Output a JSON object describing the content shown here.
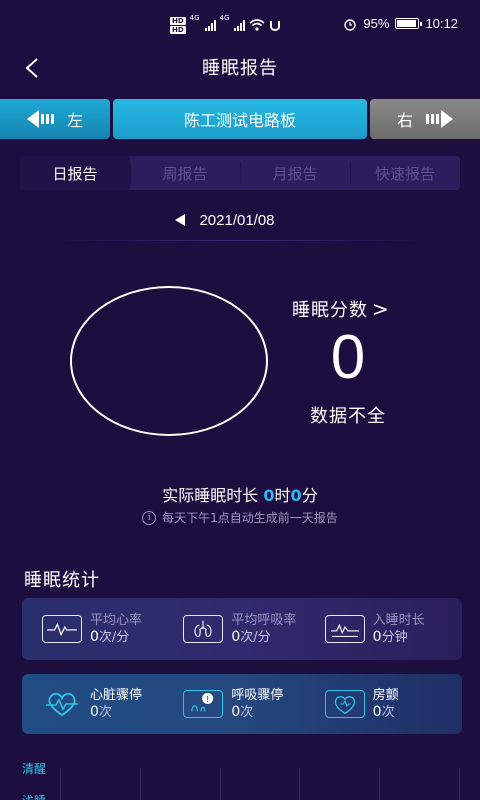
{
  "status_bar": {
    "battery": "95%",
    "time": "10:12",
    "network": "4G"
  },
  "header": {
    "title": "睡眠报告"
  },
  "device_bar": {
    "left_label": "左",
    "device_name": "陈工测试电路板",
    "right_label": "右"
  },
  "tabs": [
    {
      "label": "日报告"
    },
    {
      "label": "周报告"
    },
    {
      "label": "月报告"
    },
    {
      "label": "快速报告"
    }
  ],
  "date": "2021/01/08",
  "score": {
    "label": "睡眠分数",
    "value": "0",
    "status": "数据不全"
  },
  "duration": {
    "label": "实际睡眠时长",
    "hours": "0",
    "hours_unit": "时",
    "minutes": "0",
    "minutes_unit": "分"
  },
  "hint": "每天下午1点自动生成前一天报告",
  "stats": {
    "title": "睡眠统计",
    "row1": [
      {
        "icon": "heart-rate-monitor-icon",
        "label": "平均心率",
        "value": "0",
        "unit": "次/分"
      },
      {
        "icon": "lungs-icon",
        "label": "平均呼吸率",
        "value": "0",
        "unit": "次/分"
      },
      {
        "icon": "waveform-monitor-icon",
        "label": "入睡时长",
        "value": "0",
        "unit": "分钟"
      }
    ],
    "row2": [
      {
        "icon": "heart-pulse-icon",
        "label": "心脏骤停",
        "value": "0",
        "unit": "次"
      },
      {
        "icon": "breath-alert-icon",
        "label": "呼吸骤停",
        "value": "0",
        "unit": "次"
      },
      {
        "icon": "heart-flutter-icon",
        "label": "房颤",
        "value": "0",
        "unit": "次"
      }
    ]
  },
  "sleep_chart": {
    "legend": [
      "清醒",
      "浅睡"
    ]
  }
}
